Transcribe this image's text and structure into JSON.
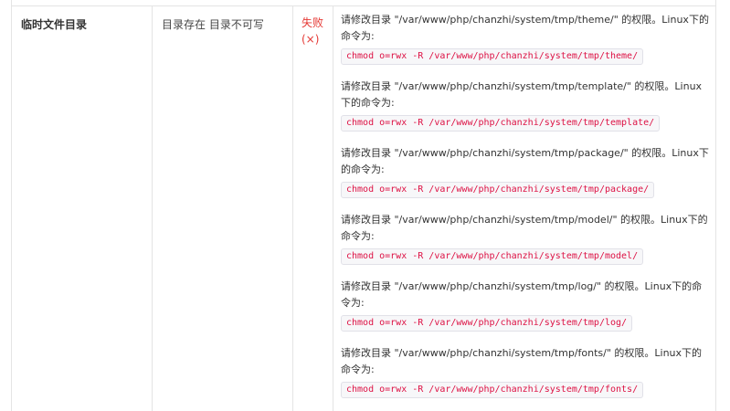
{
  "row": {
    "name": "临时文件目录",
    "status": "目录存在 目录不可写",
    "result_label": "失败",
    "result_mark": "(×)"
  },
  "fixes": [
    {
      "message": "请修改目录 \"/var/www/php/chanzhi/system/tmp/theme/\" 的权限。Linux下的命令为:",
      "command": "chmod o=rwx -R /var/www/php/chanzhi/system/tmp/theme/"
    },
    {
      "message": "请修改目录 \"/var/www/php/chanzhi/system/tmp/template/\" 的权限。Linux下的命令为:",
      "command": "chmod o=rwx -R /var/www/php/chanzhi/system/tmp/template/"
    },
    {
      "message": "请修改目录 \"/var/www/php/chanzhi/system/tmp/package/\" 的权限。Linux下的命令为:",
      "command": "chmod o=rwx -R /var/www/php/chanzhi/system/tmp/package/"
    },
    {
      "message": "请修改目录 \"/var/www/php/chanzhi/system/tmp/model/\" 的权限。Linux下的命令为:",
      "command": "chmod o=rwx -R /var/www/php/chanzhi/system/tmp/model/"
    },
    {
      "message": "请修改目录 \"/var/www/php/chanzhi/system/tmp/log/\" 的权限。Linux下的命令为:",
      "command": "chmod o=rwx -R /var/www/php/chanzhi/system/tmp/log/"
    },
    {
      "message": "请修改目录 \"/var/www/php/chanzhi/system/tmp/fonts/\" 的权限。Linux下的命令为:",
      "command": "chmod o=rwx -R /var/www/php/chanzhi/system/tmp/fonts/"
    }
  ]
}
